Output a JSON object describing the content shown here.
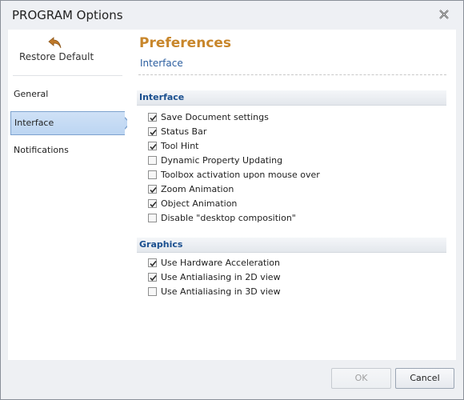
{
  "window": {
    "title": "PROGRAM Options"
  },
  "sidebar": {
    "restore_label": "Restore Default",
    "items": [
      {
        "label": "General",
        "selected": false
      },
      {
        "label": "Interface",
        "selected": true
      },
      {
        "label": "Notifications",
        "selected": false
      }
    ]
  },
  "main": {
    "title": "Preferences",
    "subtitle": "Interface",
    "sections": [
      {
        "header": "Interface",
        "options": [
          {
            "label": "Save Document settings",
            "checked": true
          },
          {
            "label": "Status Bar",
            "checked": true
          },
          {
            "label": "Tool Hint",
            "checked": true
          },
          {
            "label": "Dynamic Property Updating",
            "checked": false
          },
          {
            "label": "Toolbox activation upon mouse over",
            "checked": false
          },
          {
            "label": "Zoom Animation",
            "checked": true
          },
          {
            "label": "Object Animation",
            "checked": true
          },
          {
            "label": "Disable \"desktop composition\"",
            "checked": false
          }
        ]
      },
      {
        "header": "Graphics",
        "options": [
          {
            "label": "Use Hardware Acceleration",
            "checked": true
          },
          {
            "label": "Use Antialiasing in 2D view",
            "checked": true
          },
          {
            "label": "Use Antialiasing in 3D view",
            "checked": false
          }
        ]
      }
    ]
  },
  "footer": {
    "ok_label": "OK",
    "ok_enabled": false,
    "cancel_label": "Cancel"
  },
  "colors": {
    "accent": "#c8862b",
    "header_text": "#1a4f8f",
    "selection": "#bcd5f2"
  }
}
